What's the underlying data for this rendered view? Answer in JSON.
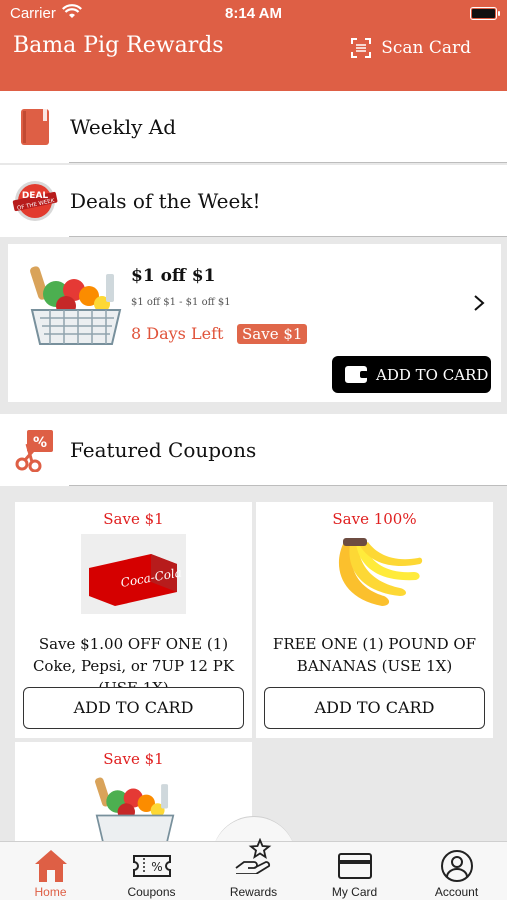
{
  "status_bar": {
    "carrier": "Carrier",
    "time": "8:14 AM"
  },
  "header": {
    "title": "Bama Pig Rewards",
    "scan_label": "Scan Card"
  },
  "sections": {
    "weekly_ad": "Weekly Ad",
    "deals": "Deals of the Week!",
    "deals_badge_line1": "DEAL",
    "deals_badge_line2": "OF THE WEEK",
    "featured": "Featured Coupons"
  },
  "deal": {
    "title": "$1 off $1",
    "subtitle": "$1 off $1 - $1 off $1",
    "days_left": "8 Days Left",
    "save": "Save $1",
    "add_button": "ADD TO CARD"
  },
  "coupons": [
    {
      "save": "Save $1",
      "desc": "Save $1.00 OFF ONE (1) Coke, Pepsi, or 7UP 12 PK (USE 1X)",
      "button": "ADD TO CARD",
      "image": "coke-12-pack",
      "brand_text": "Coca-Cola"
    },
    {
      "save": "Save 100%",
      "desc": "FREE ONE (1) POUND OF BANANAS (USE 1X)",
      "button": "ADD TO CARD",
      "image": "bananas"
    },
    {
      "save": "Save $1",
      "image": "grocery-basket"
    }
  ],
  "tabs": [
    {
      "label": "Home",
      "icon": "home-icon",
      "active": true
    },
    {
      "label": "Coupons",
      "icon": "coupon-ticket-icon"
    },
    {
      "label": "Rewards",
      "icon": "rewards-hand-star-icon"
    },
    {
      "label": "My Card",
      "icon": "card-icon"
    },
    {
      "label": "Account",
      "icon": "account-user-icon"
    }
  ],
  "colors": {
    "brand": "#de5f45",
    "save_red": "#e02020",
    "badge": "#e0674a"
  }
}
